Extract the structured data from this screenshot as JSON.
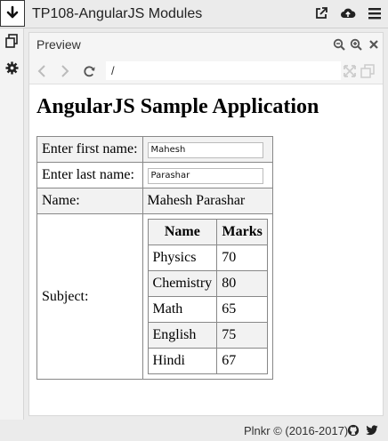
{
  "app": {
    "title": "TP108-AngularJS Modules",
    "icons": [
      "download-icon",
      "external-link-icon",
      "cloud-upload-icon",
      "hamburger-menu-icon"
    ]
  },
  "sidebar": {
    "icons": [
      "files-icon",
      "gear-icon"
    ]
  },
  "preview": {
    "title": "Preview",
    "icons": [
      "zoom-out-icon",
      "zoom-in-icon",
      "close-icon"
    ],
    "url": "/",
    "nav_icons": [
      "back-arrow-icon",
      "forward-arrow-icon",
      "refresh-icon",
      "expand-icon",
      "popout-icon"
    ]
  },
  "page": {
    "heading": "AngularJS Sample Application",
    "first_name_label": "Enter first name:",
    "first_name_value": "Mahesh",
    "last_name_label": "Enter last name:",
    "last_name_value": "Parashar",
    "name_label": "Name:",
    "name_value": "Mahesh Parashar",
    "subject_label": "Subject:",
    "subjects": {
      "headers": [
        "Name",
        "Marks"
      ],
      "rows": [
        {
          "name": "Physics",
          "marks": "70"
        },
        {
          "name": "Chemistry",
          "marks": "80"
        },
        {
          "name": "Math",
          "marks": "65"
        },
        {
          "name": "English",
          "marks": "75"
        },
        {
          "name": "Hindi",
          "marks": "67"
        }
      ]
    }
  },
  "footer": {
    "text": "Plnkr © (2016-2017)",
    "icons": [
      "github-icon",
      "twitter-icon"
    ]
  }
}
